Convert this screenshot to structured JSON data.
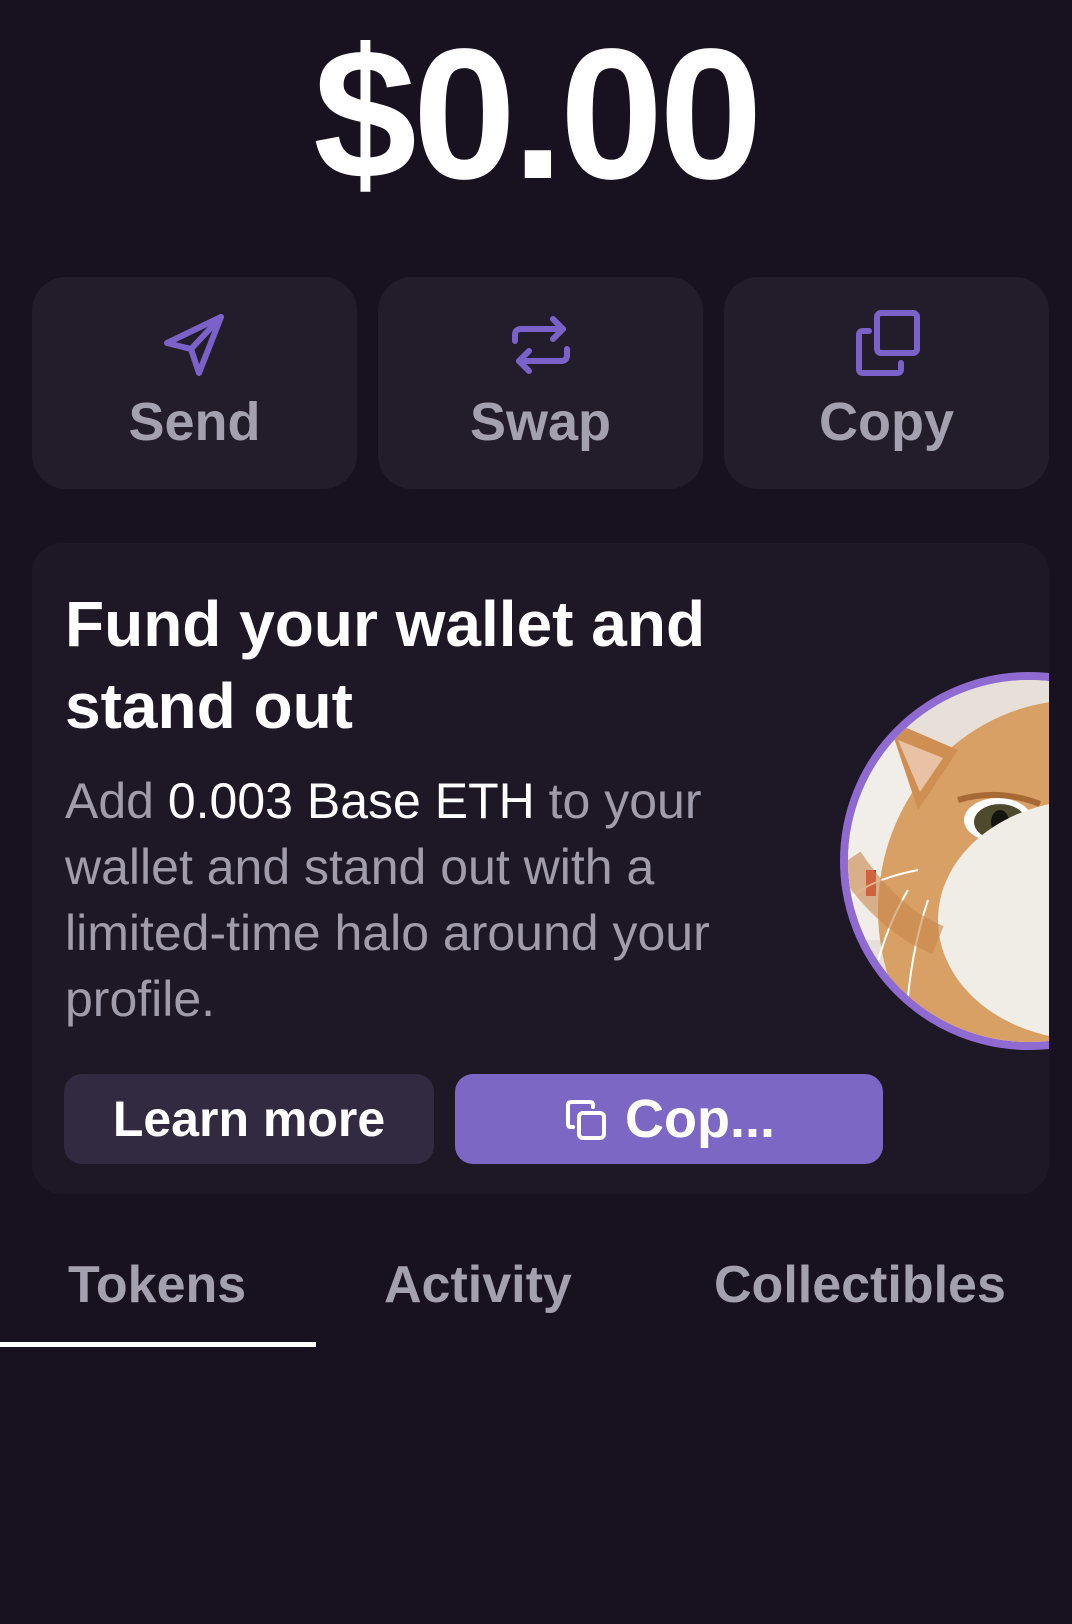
{
  "balance": "$0.00",
  "actions": [
    {
      "label": "Send",
      "icon": "send-icon"
    },
    {
      "label": "Swap",
      "icon": "swap-icon"
    },
    {
      "label": "Copy",
      "icon": "copy-icon"
    }
  ],
  "promo": {
    "title": "Fund your wallet and stand out",
    "body_prefix": "Add ",
    "body_highlight": "0.003 Base ETH",
    "body_suffix": " to your wallet and stand out with a limited-time halo around your profile.",
    "learn_more_label": "Learn more",
    "copy_label": "Cop...",
    "avatar": "cat-avatar"
  },
  "tabs": [
    {
      "label": "Tokens",
      "active": true
    },
    {
      "label": "Activity",
      "active": false
    },
    {
      "label": "Collectibles",
      "active": false
    }
  ],
  "colors": {
    "background": "#18111f",
    "card": "#231d2b",
    "accent": "#7c67c4",
    "icon_accent": "#7b62c9",
    "muted_text": "#a3a1b0"
  }
}
